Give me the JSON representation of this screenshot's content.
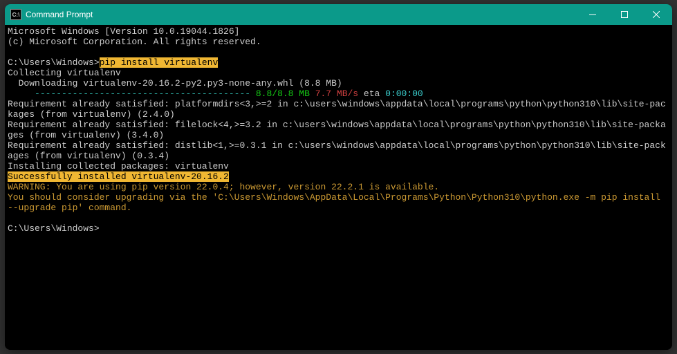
{
  "titlebar": {
    "icon_label": "C:\\",
    "title": "Command Prompt"
  },
  "term": {
    "l1": "Microsoft Windows [Version 10.0.19044.1826]",
    "l2": "(c) Microsoft Corporation. All rights reserved.",
    "blank1": " ",
    "prompt1": "C:\\Users\\Windows>",
    "cmd1": "pip install virtualenv",
    "l4": "Collecting virtualenv",
    "l5": "  Downloading virtualenv-20.16.2-py2.py3-none-any.whl (8.8 MB)",
    "progress_pad": "     ",
    "progress_dashes": "---------------------------------------- ",
    "progress_size": "8.8/8.8 MB",
    "progress_speed": " 7.7 MB/s",
    "progress_eta_label": " eta ",
    "progress_eta": "0:00:00",
    "l7": "Requirement already satisfied: platformdirs<3,>=2 in c:\\users\\windows\\appdata\\local\\programs\\python\\python310\\lib\\site-packages (from virtualenv) (2.4.0)",
    "l8": "Requirement already satisfied: filelock<4,>=3.2 in c:\\users\\windows\\appdata\\local\\programs\\python\\python310\\lib\\site-packages (from virtualenv) (3.4.0)",
    "l9": "Requirement already satisfied: distlib<1,>=0.3.1 in c:\\users\\windows\\appdata\\local\\programs\\python\\python310\\lib\\site-packages (from virtualenv) (0.3.4)",
    "l10": "Installing collected packages: virtualenv",
    "success": "Successfully installed virtualenv-20.16.2",
    "warn1": "WARNING: You are using pip version 22.0.4; however, version 22.2.1 is available.",
    "warn2": "You should consider upgrading via the 'C:\\Users\\Windows\\AppData\\Local\\Programs\\Python\\Python310\\python.exe -m pip install --upgrade pip' command.",
    "blank2": " ",
    "prompt2": "C:\\Users\\Windows>"
  }
}
